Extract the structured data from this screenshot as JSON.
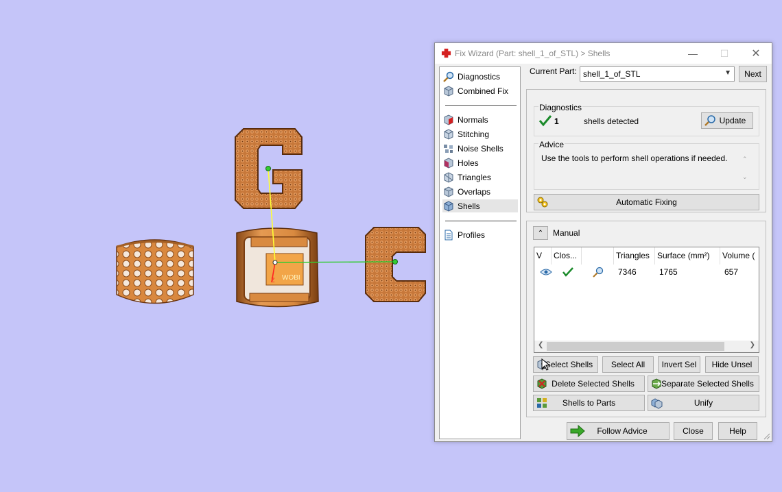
{
  "window": {
    "title": "Fix Wizard (Part: shell_1_of_STL) > Shells",
    "minimize": "—",
    "maximize": "☐",
    "close": "✕"
  },
  "nav": {
    "items": [
      {
        "label": "Diagnostics",
        "icon": "magnifier-icon"
      },
      {
        "label": "Combined Fix",
        "icon": "cube-icon"
      },
      {
        "label": "Normals",
        "icon": "normals-cube-icon"
      },
      {
        "label": "Stitching",
        "icon": "stitching-cube-icon"
      },
      {
        "label": "Noise Shells",
        "icon": "noise-shells-icon"
      },
      {
        "label": "Holes",
        "icon": "holes-cube-icon"
      },
      {
        "label": "Triangles",
        "icon": "triangles-cube-icon"
      },
      {
        "label": "Overlaps",
        "icon": "overlaps-cube-icon"
      },
      {
        "label": "Shells",
        "icon": "shells-cube-icon"
      },
      {
        "label": "Profiles",
        "icon": "document-icon"
      }
    ],
    "active": "Shells"
  },
  "current_part": {
    "label": "Current Part:",
    "value": "shell_1_of_STL",
    "next": "Next"
  },
  "diagnostics": {
    "title": "Diagnostics",
    "count": "1",
    "text": "shells detected",
    "update": "Update"
  },
  "advice": {
    "title": "Advice",
    "text": "Use the tools to perform shell operations if needed."
  },
  "automatic_fixing": "Automatic Fixing",
  "manual": {
    "title": "Manual",
    "columns": [
      "V",
      "Clos...",
      "",
      "Triangles",
      "Surface (mm²)",
      "Volume ("
    ],
    "rows": [
      {
        "triangles": "7346",
        "surface": "1765",
        "volume": "657"
      }
    ],
    "buttons": {
      "select_shells": "Select Shells",
      "select_all": "Select All",
      "invert_sel": "Invert Sel",
      "hide_unsel": "Hide Unsel",
      "delete_selected": "Delete Selected Shells",
      "separate_selected": "Separate Selected Shells",
      "shells_to_parts": "Shells to Parts",
      "unify": "Unify"
    }
  },
  "footer": {
    "follow_advice": "Follow Advice",
    "close": "Close",
    "help": "Help"
  },
  "viewport": {
    "part_label": "WOBI",
    "axis_z": "Z"
  },
  "colors": {
    "background": "#c5c5f9",
    "part": "#d27f3a",
    "check": "#1a8a2a",
    "y_axis": "#ffff33",
    "x_axis": "#33cc33"
  }
}
